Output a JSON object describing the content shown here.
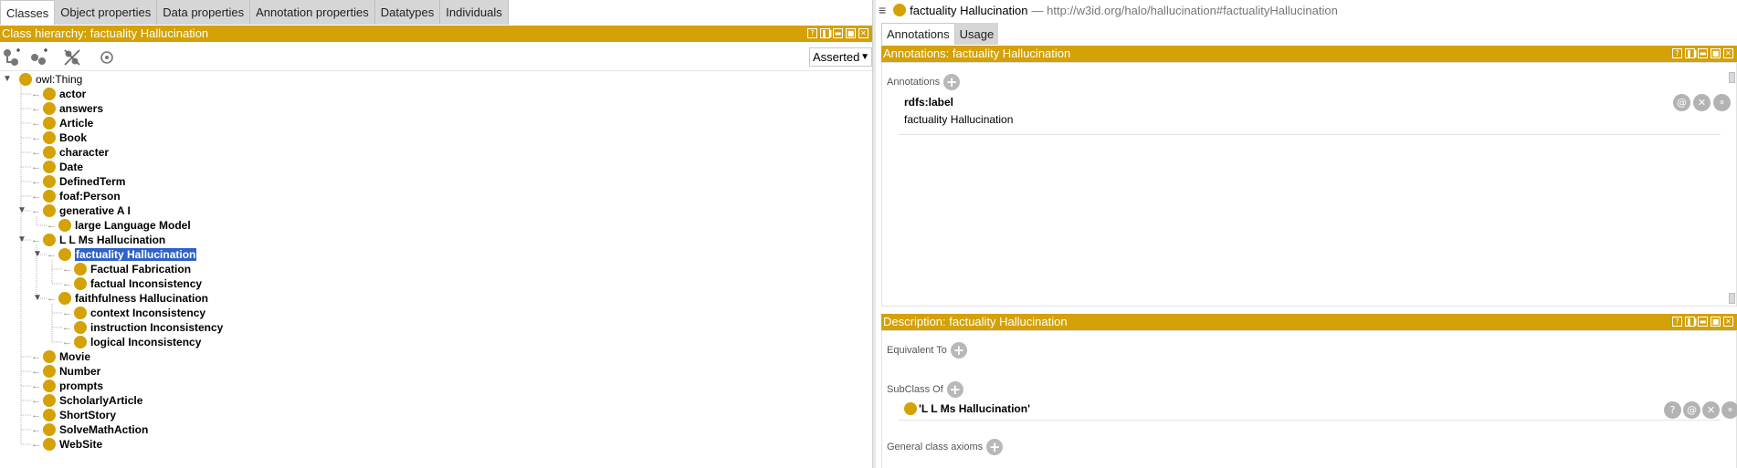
{
  "left": {
    "tabs": [
      "Classes",
      "Object properties",
      "Data properties",
      "Annotation properties",
      "Datatypes",
      "Individuals"
    ],
    "hierarchy_title": "Class hierarchy: factuality Hallucination",
    "asserted": "Asserted",
    "toolbar_icons": [
      "add-subclass-icon",
      "add-sibling-class-icon",
      "delete-class-icon",
      "watch-class-icon"
    ],
    "window_buttons": [
      "?",
      "❚❚",
      "▬",
      "■",
      "✕"
    ],
    "tree": [
      {
        "label": "owl:Thing",
        "depth": 0,
        "expanded": true,
        "root": true
      },
      {
        "label": "actor",
        "depth": 1
      },
      {
        "label": "answers",
        "depth": 1
      },
      {
        "label": "Article",
        "depth": 1
      },
      {
        "label": "Book",
        "depth": 1
      },
      {
        "label": "character",
        "depth": 1
      },
      {
        "label": "Date",
        "depth": 1
      },
      {
        "label": "DefinedTerm",
        "depth": 1
      },
      {
        "label": "foaf:Person",
        "depth": 1
      },
      {
        "label": "generative A I",
        "depth": 1,
        "expanded": true
      },
      {
        "label": "large Language Model",
        "depth": 2
      },
      {
        "label": "L L Ms Hallucination",
        "depth": 1,
        "expanded": true
      },
      {
        "label": "factuality Hallucination",
        "depth": 2,
        "expanded": true,
        "selected": true
      },
      {
        "label": "Factual Fabrication",
        "depth": 3
      },
      {
        "label": "factual Inconsistency",
        "depth": 3
      },
      {
        "label": "faithfulness Hallucination",
        "depth": 2,
        "expanded": true
      },
      {
        "label": "context Inconsistency",
        "depth": 3
      },
      {
        "label": "instruction Inconsistency",
        "depth": 3
      },
      {
        "label": "logical Inconsistency",
        "depth": 3
      },
      {
        "label": "Movie",
        "depth": 1
      },
      {
        "label": "Number",
        "depth": 1
      },
      {
        "label": "prompts",
        "depth": 1
      },
      {
        "label": "ScholarlyArticle",
        "depth": 1
      },
      {
        "label": "ShortStory",
        "depth": 1
      },
      {
        "label": "SolveMathAction",
        "depth": 1
      },
      {
        "label": "WebSite",
        "depth": 1
      }
    ]
  },
  "right": {
    "entity_name": "factuality Hallucination",
    "entity_iri": "— http://w3id.org/halo/hallucination#factualityHallucination",
    "tabs": [
      "Annotations",
      "Usage"
    ],
    "annotations_header": "Annotations: factuality Hallucination",
    "annotations_label": "Annotations",
    "annotation_property": "rdfs:label",
    "annotation_value": "factuality Hallucination",
    "description_header": "Description: factuality Hallucination",
    "equivalent_to": "Equivalent To",
    "subclass_of": "SubClass Of",
    "subclass_value": "'L L Ms Hallucination'",
    "general_axioms": "General class axioms",
    "ann_buttons": [
      "@",
      "✕",
      "⚬"
    ],
    "sub_buttons": [
      "?",
      "@",
      "✕",
      "⚬"
    ]
  },
  "colors": {
    "accent": "#d4a106",
    "selection": "#2f62c8"
  }
}
